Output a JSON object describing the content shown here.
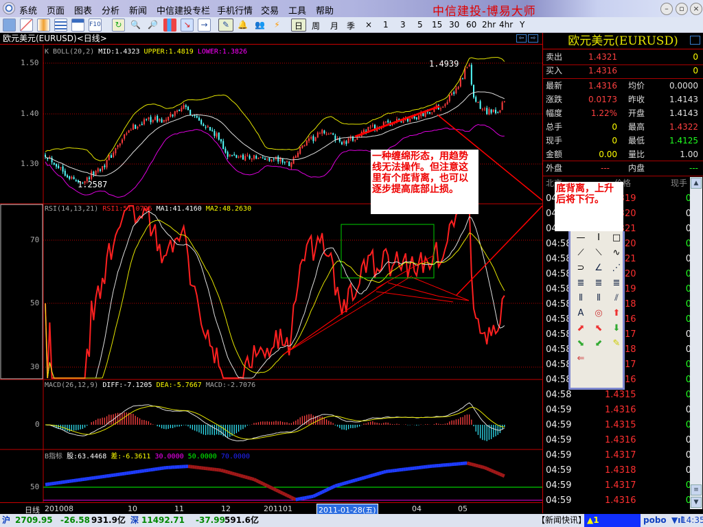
{
  "app": {
    "title": "中信建投-博易大师",
    "window_buttons": [
      "minimize",
      "restore",
      "close"
    ]
  },
  "menu": [
    "系统",
    "页面",
    "图表",
    "分析",
    "新闻",
    "中信建投专栏",
    "手机行情",
    "交易",
    "工具",
    "帮助"
  ],
  "toolbar": {
    "periods": [
      "日",
      "周",
      "月",
      "季",
      "×",
      "1",
      "3",
      "5",
      "15",
      "30",
      "60",
      "2hr",
      "4hr",
      "Y"
    ],
    "selected_period": "日"
  },
  "chart_title": "欧元美元(EURUSD)<日线>",
  "indicators": {
    "boll": {
      "name": "K  BOLL(20,2)",
      "mid": "MID:1.4323",
      "upper": "UPPER:1.4819",
      "lower": "LOWER:1.3826"
    },
    "rsi": {
      "name": "RSI(14,13,21)",
      "rsi1": "RSI1:51.0726",
      "ma1": "MA1:41.4160",
      "ma2": "MA2:48.2630"
    },
    "macd": {
      "name": "MACD(26,12,9)",
      "diff": "DIFF:-7.1205",
      "dea": "DEA:-5.7667",
      "macd": "MACD:-2.7076"
    },
    "b": {
      "name": "B指标",
      "gu": "股:63.4468",
      "cha": "差:-6.3611",
      "l30": "30.0000",
      "l50": "50.0000",
      "l70": "70.0000"
    }
  },
  "axes": {
    "price": [
      "1.50",
      "1.40",
      "1.30"
    ],
    "rsi": [
      "70",
      "50",
      "30"
    ],
    "macd": [
      "0"
    ],
    "b": [
      "50"
    ],
    "date_label": "日线",
    "dates": [
      "201008",
      "10",
      "11",
      "12",
      "201101",
      "2011-01-28(五)",
      "04",
      "05"
    ]
  },
  "markers": {
    "high": "1.4939",
    "low": "1.2587"
  },
  "notes": {
    "note1": "一种缠绵形态，用趋势线无法操作。但注意这里有个底背离，也可以逐步提高底部止损。",
    "note2": "底背离，上升后将下行。"
  },
  "quote": {
    "name": "欧元美元(EURUSD)",
    "sell": {
      "label": "卖出",
      "price": "1.4321",
      "vol": "0"
    },
    "buy": {
      "label": "买入",
      "price": "1.4316",
      "vol": "0"
    },
    "rows": [
      {
        "l1": "最新",
        "v1": "1.4316",
        "c1": "#ff4040",
        "l2": "均价",
        "v2": "0.0000",
        "c2": "#e0e0e0"
      },
      {
        "l1": "涨跌",
        "v1": "0.0173",
        "c1": "#ff4040",
        "l2": "昨收",
        "v2": "1.4143",
        "c2": "#e0e0e0"
      },
      {
        "l1": "幅度",
        "v1": "1.22%",
        "c1": "#ff4040",
        "l2": "开盘",
        "v2": "1.4143",
        "c2": "#e0e0e0"
      },
      {
        "l1": "总手",
        "v1": "0",
        "c1": "#ffff00",
        "l2": "最高",
        "v2": "1.4322",
        "c2": "#ff4040"
      },
      {
        "l1": "现手",
        "v1": "0",
        "c1": "#ffff00",
        "l2": "最低",
        "v2": "1.4125",
        "c2": "#20ff20"
      },
      {
        "l1": "金额",
        "v1": "0.00",
        "c1": "#ffff00",
        "l2": "量比",
        "v2": "1.00",
        "c2": "#e0e0e0"
      }
    ],
    "outer": {
      "label": "外盘",
      "value": "---"
    },
    "inner": {
      "label": "内盘",
      "value": "---"
    },
    "tick_header": [
      "北京",
      "价格",
      "现手"
    ]
  },
  "ticks": [
    {
      "t": "04:57",
      "p": "1.4319",
      "v": "0",
      "g": true
    },
    {
      "t": "04:57",
      "p": "1.4320",
      "v": "0",
      "g": false
    },
    {
      "t": "04:57",
      "p": "1.4321",
      "v": "0",
      "g": false
    },
    {
      "t": "04:58",
      "p": "1.4320",
      "v": "0",
      "g": true
    },
    {
      "t": "04:58",
      "p": "1.4321",
      "v": "0",
      "g": false
    },
    {
      "t": "04:58",
      "p": "1.4320",
      "v": "0",
      "g": true
    },
    {
      "t": "04:58",
      "p": "1.4319",
      "v": "0",
      "g": true
    },
    {
      "t": "04:58",
      "p": "1.4318",
      "v": "0",
      "g": true
    },
    {
      "t": "04:58",
      "p": "1.4316",
      "v": "0",
      "g": true
    },
    {
      "t": "04:58",
      "p": "1.4317",
      "v": "0",
      "g": false
    },
    {
      "t": "04:58",
      "p": "1.4318",
      "v": "0",
      "g": false
    },
    {
      "t": "04:58",
      "p": "1.4317",
      "v": "0",
      "g": true
    },
    {
      "t": "04:58",
      "p": "1.4316",
      "v": "0",
      "g": true
    },
    {
      "t": "04:58",
      "p": "1.4315",
      "v": "0",
      "g": true
    },
    {
      "t": "04:59",
      "p": "1.4316",
      "v": "0",
      "g": false
    },
    {
      "t": "04:59",
      "p": "1.4315",
      "v": "0",
      "g": true
    },
    {
      "t": "04:59",
      "p": "1.4316",
      "v": "0",
      "g": false
    },
    {
      "t": "04:59",
      "p": "1.4317",
      "v": "0",
      "g": false
    },
    {
      "t": "04:59",
      "p": "1.4318",
      "v": "0",
      "g": false
    },
    {
      "t": "04:59",
      "p": "1.4317",
      "v": "0",
      "g": true
    },
    {
      "t": "04:59",
      "p": "1.4316",
      "v": "0",
      "g": true
    }
  ],
  "toolbox_tools": [
    "horizontal-line",
    "vertical-line",
    "rectangle",
    "line",
    "segment",
    "sine",
    "arc",
    "angle",
    "fan",
    "gann-line",
    "fib-line",
    "fib-line-2",
    "cycle-lines",
    "cycle-lines-2",
    "speed-lines",
    "text",
    "circle",
    "up-arrow",
    "up-right-arrow",
    "up-left-arrow",
    "down-arrow",
    "down-right-arrow",
    "down-left-arrow",
    "eraser",
    "delete-all"
  ],
  "status": {
    "sh_label": "沪",
    "sh_index": "2709.95",
    "sh_change": "-26.58",
    "sh_amount": "931.9亿",
    "sz_label": "深",
    "sz_index": "11492.71",
    "sz_change": "-37.99",
    "sz_amount": "591.6亿",
    "news": "【新闻快讯】",
    "alert": "▲1",
    "brand": "pobo",
    "time": "14:35"
  },
  "colors": {
    "up": "#ff3c3c",
    "down": "#54ffff",
    "grid": "#c00000",
    "mid": "#e0e0e0",
    "upper": "#e6e600",
    "lower": "#e000e0"
  },
  "chart_data": {
    "type": "candlestick",
    "bars": 210,
    "price_range": [
      1.23,
      1.51
    ],
    "close_path": [
      [
        0,
        1.32
      ],
      [
        11,
        1.275
      ],
      [
        15,
        1.262
      ],
      [
        20,
        1.275
      ],
      [
        27,
        1.3
      ],
      [
        39,
        1.37
      ],
      [
        47,
        1.39
      ],
      [
        55,
        1.385
      ],
      [
        62,
        1.415
      ],
      [
        70,
        1.39
      ],
      [
        80,
        1.345
      ],
      [
        83,
        1.315
      ],
      [
        92,
        1.315
      ],
      [
        98,
        1.31
      ],
      [
        105,
        1.31
      ],
      [
        111,
        1.3
      ],
      [
        117,
        1.335
      ],
      [
        127,
        1.365
      ],
      [
        136,
        1.34
      ],
      [
        142,
        1.355
      ],
      [
        148,
        1.37
      ],
      [
        161,
        1.385
      ],
      [
        170,
        1.395
      ],
      [
        180,
        1.415
      ],
      [
        186,
        1.44
      ],
      [
        191,
        1.485
      ],
      [
        193,
        1.49
      ],
      [
        195,
        1.43
      ],
      [
        198,
        1.41
      ],
      [
        205,
        1.4
      ],
      [
        209,
        1.425
      ]
    ],
    "b_indicator_path": [
      [
        0,
        54
      ],
      [
        30,
        68
      ],
      [
        55,
        80
      ],
      [
        65,
        82
      ],
      [
        80,
        76
      ],
      [
        95,
        62
      ],
      [
        114,
        31
      ],
      [
        122,
        36
      ],
      [
        132,
        52
      ],
      [
        155,
        74
      ],
      [
        175,
        82
      ],
      [
        192,
        87
      ],
      [
        200,
        80
      ],
      [
        209,
        67
      ]
    ],
    "rsi_levels": [
      30,
      50,
      70
    ]
  }
}
